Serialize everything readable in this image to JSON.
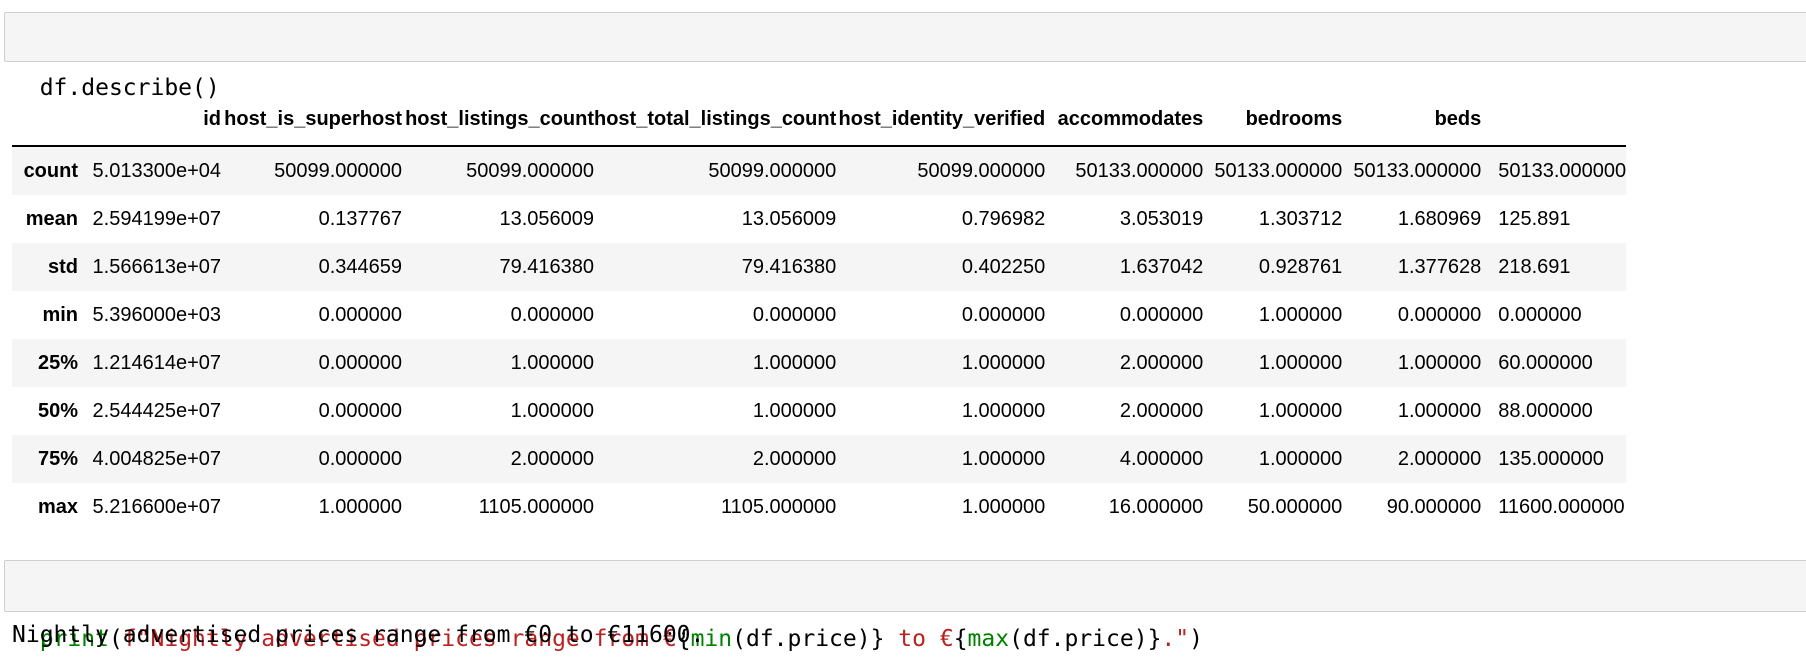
{
  "cell1": {
    "code": "df.describe()"
  },
  "describe_table": {
    "columns": [
      "id",
      "host_is_superhost",
      "host_listings_count",
      "host_total_listings_count",
      "host_identity_verified",
      "accommodates",
      "bedrooms",
      "beds",
      ""
    ],
    "rows": [
      {
        "label": "count",
        "values": [
          "5.013300e+04",
          "50099.000000",
          "50099.000000",
          "50099.000000",
          "50099.000000",
          "50133.000000",
          "50133.000000",
          "50133.000000",
          "50133.000000"
        ]
      },
      {
        "label": "mean",
        "values": [
          "2.594199e+07",
          "0.137767",
          "13.056009",
          "13.056009",
          "0.796982",
          "3.053019",
          "1.303712",
          "1.680969",
          "125.891"
        ]
      },
      {
        "label": "std",
        "values": [
          "1.566613e+07",
          "0.344659",
          "79.416380",
          "79.416380",
          "0.402250",
          "1.637042",
          "0.928761",
          "1.377628",
          "218.691"
        ]
      },
      {
        "label": "min",
        "values": [
          "5.396000e+03",
          "0.000000",
          "0.000000",
          "0.000000",
          "0.000000",
          "0.000000",
          "1.000000",
          "0.000000",
          "0.000000"
        ]
      },
      {
        "label": "25%",
        "values": [
          "1.214614e+07",
          "0.000000",
          "1.000000",
          "1.000000",
          "1.000000",
          "2.000000",
          "1.000000",
          "1.000000",
          "60.000000"
        ]
      },
      {
        "label": "50%",
        "values": [
          "2.544425e+07",
          "0.000000",
          "1.000000",
          "1.000000",
          "1.000000",
          "2.000000",
          "1.000000",
          "1.000000",
          "88.000000"
        ]
      },
      {
        "label": "75%",
        "values": [
          "4.004825e+07",
          "0.000000",
          "2.000000",
          "2.000000",
          "1.000000",
          "4.000000",
          "1.000000",
          "2.000000",
          "135.000000"
        ]
      },
      {
        "label": "max",
        "values": [
          "5.216600e+07",
          "1.000000",
          "1105.000000",
          "1105.000000",
          "1.000000",
          "16.000000",
          "50.000000",
          "90.000000",
          "11600.000000"
        ]
      }
    ]
  },
  "cell2": {
    "tokens": [
      {
        "text": "print",
        "kind": "fn"
      },
      {
        "text": "(",
        "kind": "plain"
      },
      {
        "text": "f\"Nightly advertised prices range from €",
        "kind": "str"
      },
      {
        "text": "{",
        "kind": "plain"
      },
      {
        "text": "min",
        "kind": "fn"
      },
      {
        "text": "(df.price)}",
        "kind": "plain"
      },
      {
        "text": " to €",
        "kind": "str"
      },
      {
        "text": "{",
        "kind": "plain"
      },
      {
        "text": "max",
        "kind": "fn"
      },
      {
        "text": "(df.price)}",
        "kind": "plain"
      },
      {
        "text": ".\"",
        "kind": "str"
      },
      {
        "text": ")",
        "kind": "plain"
      }
    ]
  },
  "stdout": {
    "text": "Nightly advertised prices range from €0 to €11600."
  }
}
